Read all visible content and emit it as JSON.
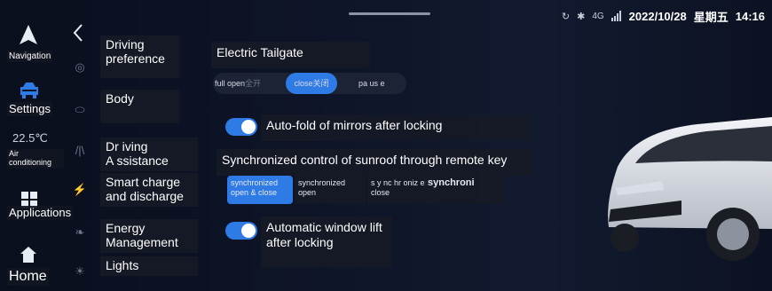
{
  "status": {
    "date": "2022/10/28",
    "weekday": "星期五",
    "time": "14:16",
    "network": "4G",
    "icons": [
      "battery-saver-icon",
      "bluetooth-icon",
      "signal-icon"
    ]
  },
  "leftnav": {
    "navigation": "Navigation",
    "settings": "Settings",
    "temperature": "22.5℃",
    "air": "Air\nconditioning",
    "applications": "Applications",
    "home": "Home"
  },
  "categories": {
    "driving": "Driving\npreference",
    "body": "Body",
    "assistance": "Dr iving\nA ssistance",
    "charge": "Smart charge\nand discharge",
    "energy": "Energy\nManagement",
    "lights": "Lights"
  },
  "main": {
    "tailgate_title": "Electric Tailgate",
    "tailgate_options": {
      "full_open": "full open",
      "full_open_cn": "全开",
      "close": "close",
      "close_cn": "关闭",
      "pause": "pa us e"
    },
    "mirror_fold": "Auto-fold of mirrors after locking",
    "sunroof_title": "Synchronized control of sunroof through remote key",
    "sunroof_options": {
      "open_close": "synchronized\nopen & close",
      "open": "synchronized\nopen",
      "close": "s y nc hr oniz ed\nclose",
      "overlay": "synchroni"
    },
    "window_lift": "Automatic window lift\nafter locking"
  },
  "colors": {
    "accent": "#2f7be6",
    "background": "#0b1020",
    "label_bg": "#161a26"
  }
}
